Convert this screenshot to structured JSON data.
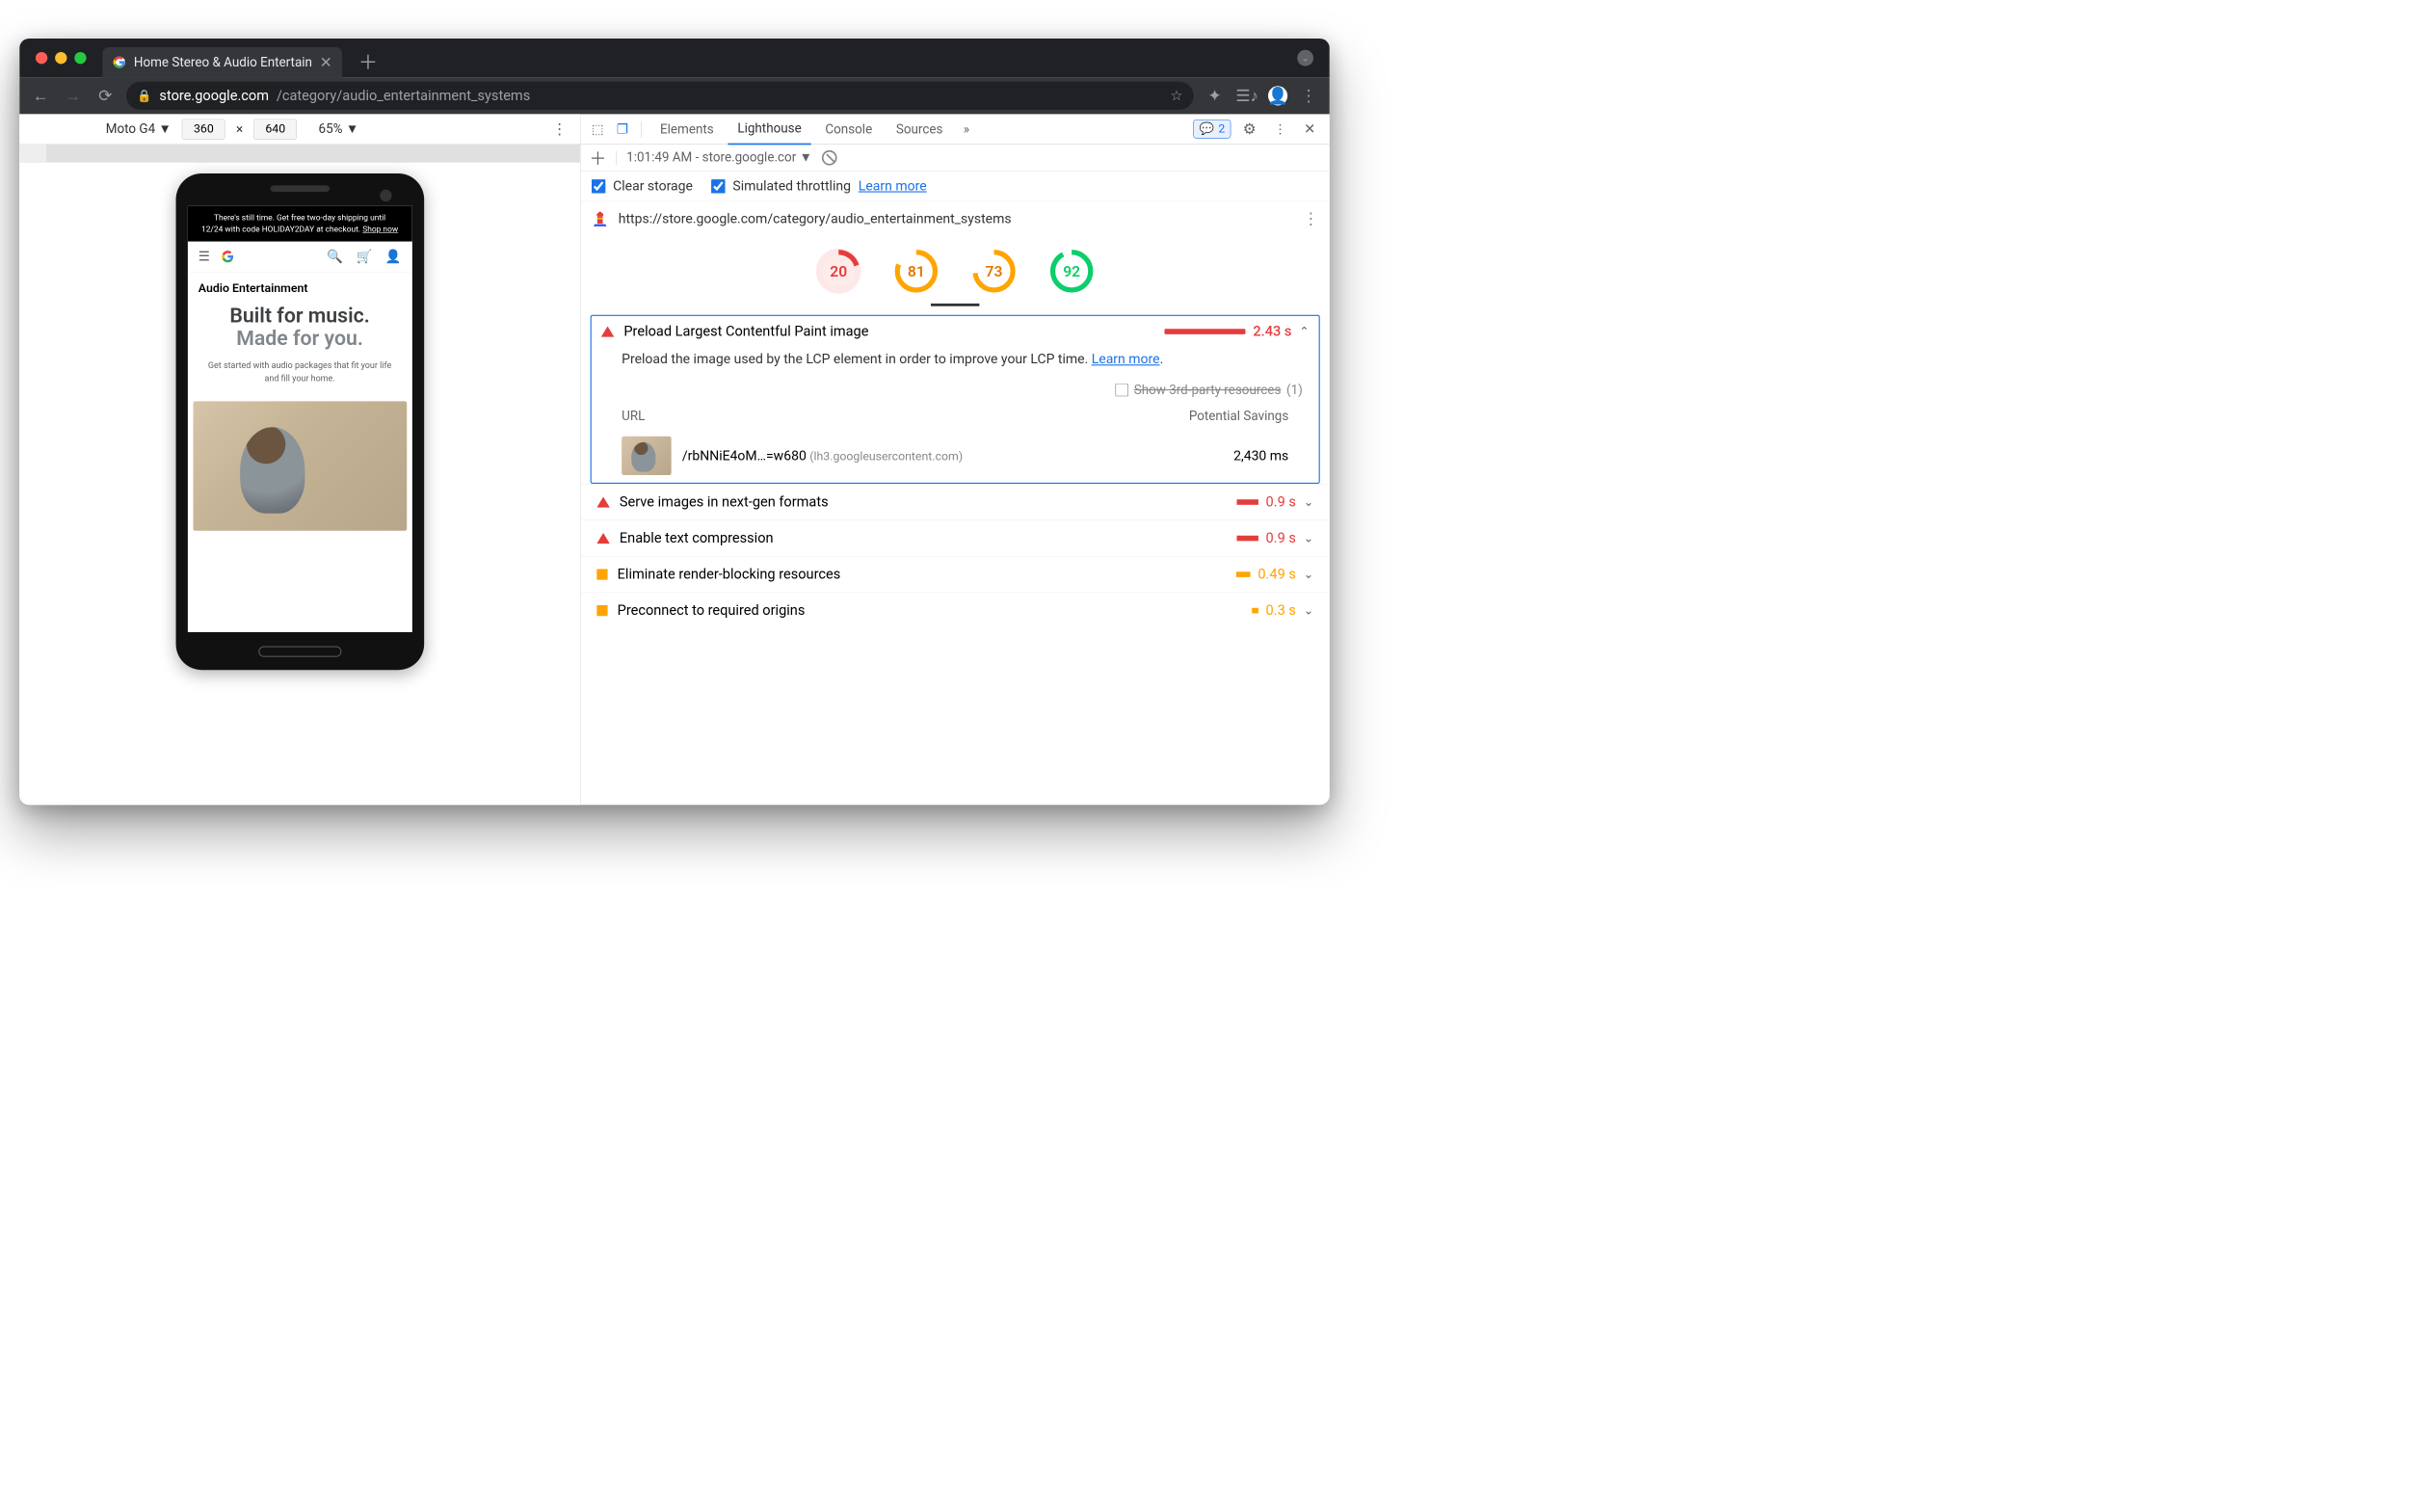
{
  "browser": {
    "tab_title": "Home Stereo & Audio Entertain",
    "url_host": "store.google.com",
    "url_path": "/category/audio_entertainment_systems"
  },
  "device_toolbar": {
    "device": "Moto G4",
    "width": "360",
    "height": "640",
    "zoom": "65%"
  },
  "phone": {
    "banner_line1": "There's still time. Get free two-day shipping until",
    "banner_line2": "12/24 with code HOLIDAY2DAY at checkout.",
    "banner_link": "Shop now",
    "category": "Audio Entertainment",
    "hero_bold1": "Built for music.",
    "hero_muted": "Made for you.",
    "hero_copy": "Get started with audio packages that fit your life and fill your home."
  },
  "devtools": {
    "tabs": {
      "elements": "Elements",
      "lighthouse": "Lighthouse",
      "console": "Console",
      "sources": "Sources"
    },
    "issue_count": "2",
    "sub_time": "1:01:49 AM - store.google.cor",
    "opt_clear": "Clear storage",
    "opt_throttle": "Simulated throttling",
    "learn_more": "Learn more",
    "audit_url": "https://store.google.com/category/audio_entertainment_systems"
  },
  "scores": {
    "perf": "20",
    "a11y": "81",
    "bp": "73",
    "seo": "92"
  },
  "main_audit": {
    "title": "Preload Largest Contentful Paint image",
    "time": "2.43 s",
    "desc": "Preload the image used by the LCP element in order to improve your LCP time.",
    "learn": "Learn more",
    "third_party": "Show 3rd-party resources",
    "third_count": "(1)",
    "col_url": "URL",
    "col_savings": "Potential Savings",
    "row_url": "/rbNNiE4oM…=w680",
    "row_host": "(lh3.googleusercontent.com)",
    "row_ms": "2,430 ms"
  },
  "audits": [
    {
      "icon": "tri",
      "title": "Serve images in next-gen formats",
      "bar": "bar-s",
      "val": "0.9 s"
    },
    {
      "icon": "tri",
      "title": "Enable text compression",
      "bar": "bar-s",
      "val": "0.9 s"
    },
    {
      "icon": "sq",
      "title": "Eliminate render-blocking resources",
      "bar": "bar-xs",
      "val": "0.49 s",
      "cls": "org"
    },
    {
      "icon": "sq",
      "title": "Preconnect to required origins",
      "bar": "bar-xxs",
      "val": "0.3 s",
      "cls": "org"
    }
  ]
}
